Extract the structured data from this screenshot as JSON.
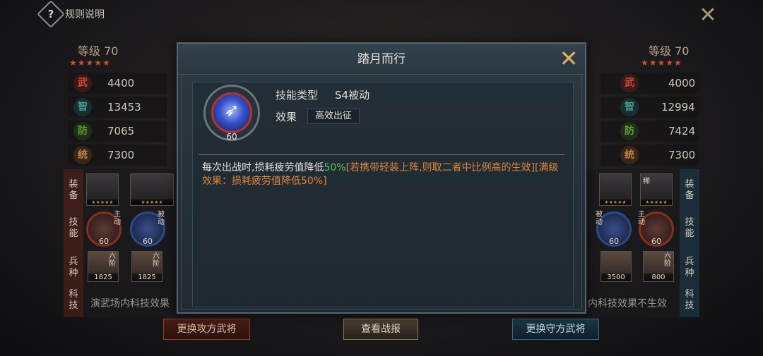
{
  "topbar": {
    "help_symbol": "?",
    "rules_label": "规则说明",
    "close_symbol": "✕"
  },
  "attacker": {
    "level": "等级 70",
    "stars": "★★★★★",
    "stats": [
      {
        "icon": "武",
        "value": "4400",
        "color": "#b8372a"
      },
      {
        "icon": "智",
        "value": "13453",
        "color": "#2d6b6a"
      },
      {
        "icon": "防",
        "value": "7065",
        "color": "#3f6b2a"
      },
      {
        "icon": "统",
        "value": "7300",
        "color": "#8a5a2a"
      }
    ],
    "row_labels": {
      "equip": "装备",
      "skill": "技能",
      "troop": "兵种",
      "tech": "科技"
    },
    "equipment_stars": "★★★★★",
    "skills": [
      {
        "level": "60",
        "tag": "主动"
      },
      {
        "level": "60",
        "tag": "被动"
      }
    ],
    "troops": [
      {
        "count": "1825",
        "tag": "六阶"
      },
      {
        "count": "1825",
        "tag": "六阶"
      }
    ],
    "tech_text": "演武场内科技效果",
    "button": "更换攻方武将"
  },
  "defender": {
    "level": "等级 70",
    "stars": "★★★★★",
    "stats": [
      {
        "icon": "武",
        "value": "4000",
        "color": "#b8372a"
      },
      {
        "icon": "智",
        "value": "12994",
        "color": "#2d6b6a"
      },
      {
        "icon": "防",
        "value": "7424",
        "color": "#3f6b2a"
      },
      {
        "icon": "统",
        "value": "7300",
        "color": "#8a5a2a"
      }
    ],
    "row_labels": {
      "equip": "装备",
      "skill": "技能",
      "troop": "兵种",
      "tech": "科技"
    },
    "equipment_stars": "★★★★★",
    "equipment_tag": "稀",
    "skills": [
      {
        "level": "60",
        "tag": "被动"
      },
      {
        "level": "60",
        "tag": "主动"
      }
    ],
    "troops": [
      {
        "count": "3500",
        "tag": ""
      },
      {
        "count": "800",
        "tag": "六阶"
      }
    ],
    "tech_text": "内科技效果不生效",
    "button": "更换守方武将"
  },
  "center_button": "查看战报",
  "modal": {
    "title": "踏月而行",
    "close_symbol": "✕",
    "skill_level": "60",
    "skill_type_label": "技能类型",
    "skill_type_value": "S4被动",
    "effect_label": "效果",
    "effect_value": "高效出征",
    "description": {
      "part1": "每次出战时,损耗疲劳值降低",
      "part2": "50%",
      "part3": "[若携带轻装上阵,则取二者中比例高的生效][满级效果：损耗疲劳值降低50%]"
    }
  }
}
